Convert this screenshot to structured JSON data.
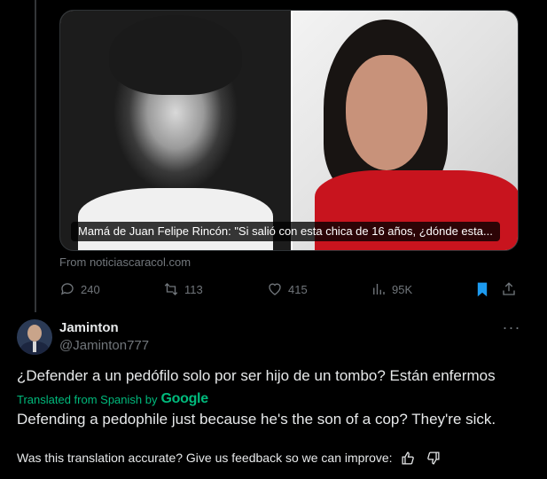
{
  "media": {
    "caption": "Mamá de Juan Felipe Rincón: \"Si salió con esta chica de 16 años, ¿dónde esta...",
    "source": "From noticiascaracol.com"
  },
  "actions": {
    "replies": "240",
    "reposts": "113",
    "likes": "415",
    "views": "95K",
    "reply_icon": "reply-icon",
    "repost_icon": "repost-icon",
    "like_icon": "heart-icon",
    "views_icon": "views-icon",
    "bookmark_icon": "bookmark-icon",
    "share_icon": "share-icon",
    "bookmark_color": "#1d9bf0"
  },
  "reply_tweet": {
    "display_name": "Jaminton",
    "handle": "@Jaminton777",
    "text": "¿Defender a un pedófilo solo por ser hijo de un tombo? Están enfermos",
    "translated_label": "Translated from Spanish by",
    "translator": "Google",
    "translation": "Defending a pedophile just because he's the son of a cop? They're sick.",
    "feedback_prompt": "Was this translation accurate? Give us feedback so we can improve:",
    "more_icon": "more-icon",
    "translated_color": "#00ba7c"
  }
}
